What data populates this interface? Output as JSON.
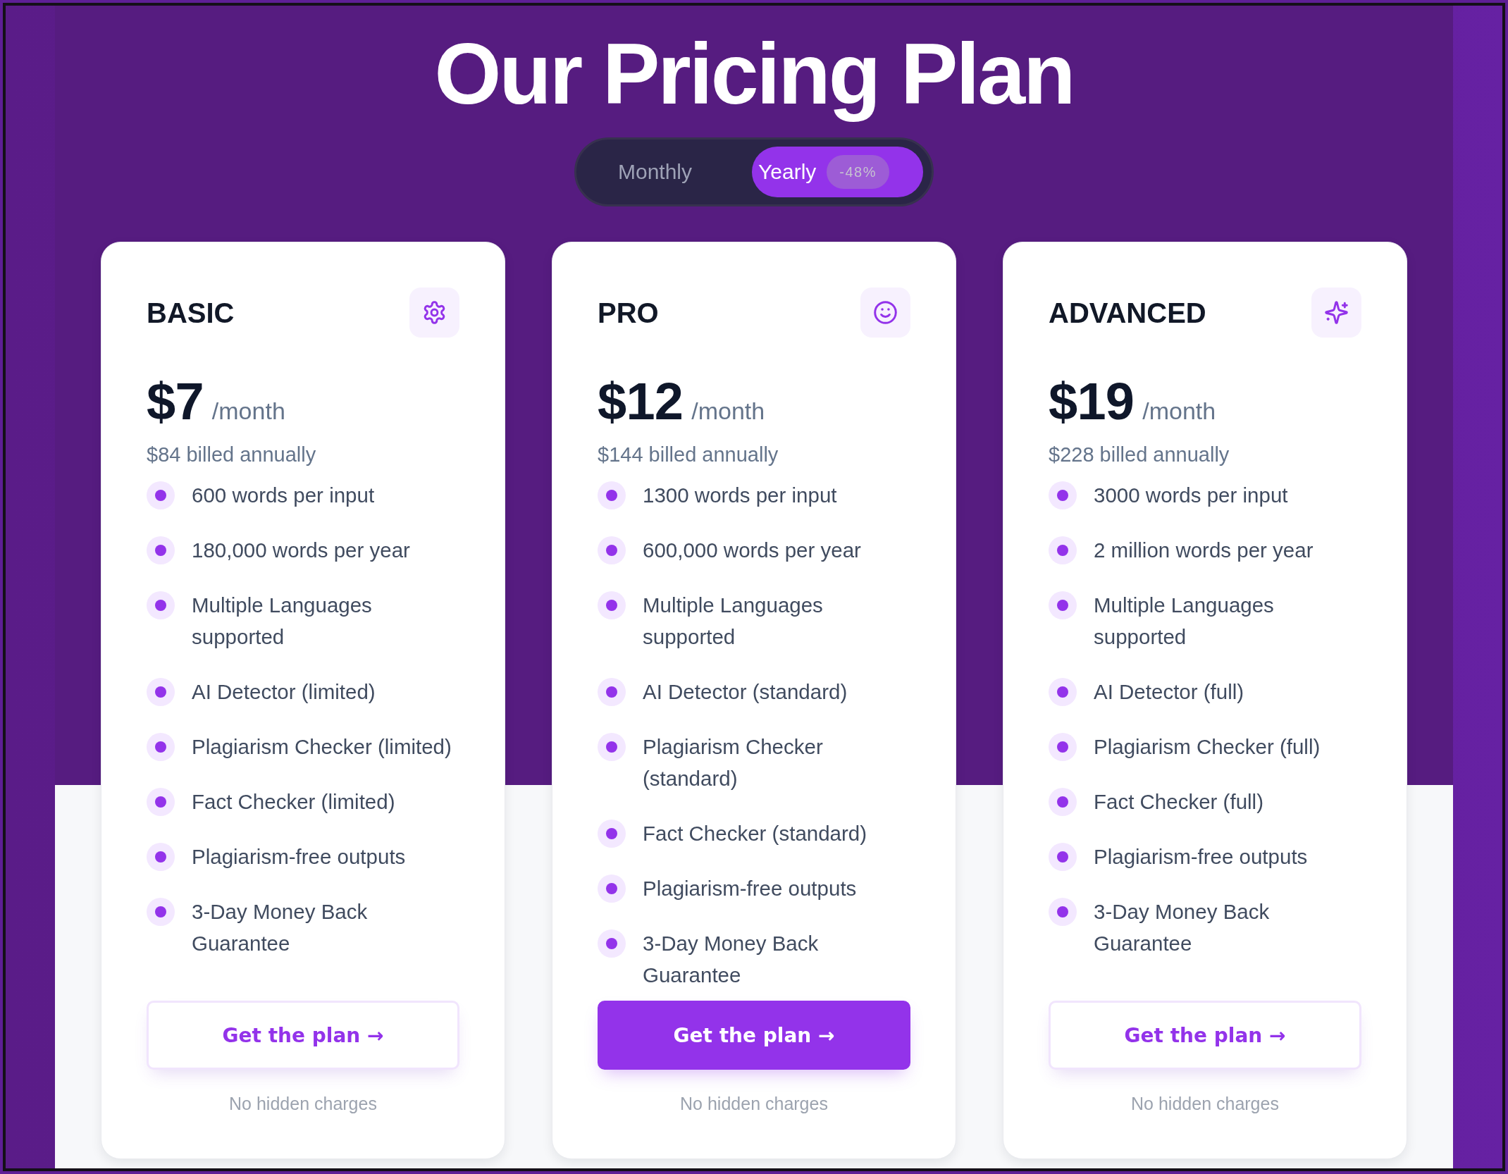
{
  "title": "Our Pricing Plan",
  "billing_toggle": {
    "options": [
      {
        "label": "Monthly",
        "selected": false
      },
      {
        "label": "Yearly",
        "selected": true,
        "badge": "-48%"
      }
    ]
  },
  "plans": [
    {
      "name": "BASIC",
      "price": "$7",
      "period": "/month",
      "billed": "$84 billed annually",
      "features": [
        "600 words per input",
        "180,000 words per year",
        "Multiple Languages supported",
        "AI Detector (limited)",
        "Plagiarism Checker (limited)",
        "Fact Checker (limited)",
        "Plagiarism-free outputs",
        "3-Day Money Back Guarantee"
      ],
      "button": "Get the plan →",
      "featured": false,
      "note": "No hidden charges"
    },
    {
      "name": "PRO",
      "price": "$12",
      "period": "/month",
      "billed": "$144 billed annually",
      "features": [
        "1300 words per input",
        "600,000 words per year",
        "Multiple Languages supported",
        "AI Detector (standard)",
        "Plagiarism Checker (standard)",
        "Fact Checker (standard)",
        "Plagiarism-free outputs",
        "3-Day Money Back Guarantee"
      ],
      "button": "Get the plan →",
      "featured": true,
      "note": "No hidden charges"
    },
    {
      "name": "ADVANCED",
      "price": "$19",
      "period": "/month",
      "billed": "$228 billed annually",
      "features": [
        "3000 words per input",
        "2 million words per year",
        "Multiple Languages supported",
        "AI Detector (full)",
        "Plagiarism Checker (full)",
        "Fact Checker (full)",
        "Plagiarism-free outputs",
        "3-Day Money Back Guarantee"
      ],
      "button": "Get the plan →",
      "featured": false,
      "note": "No hidden charges"
    }
  ]
}
